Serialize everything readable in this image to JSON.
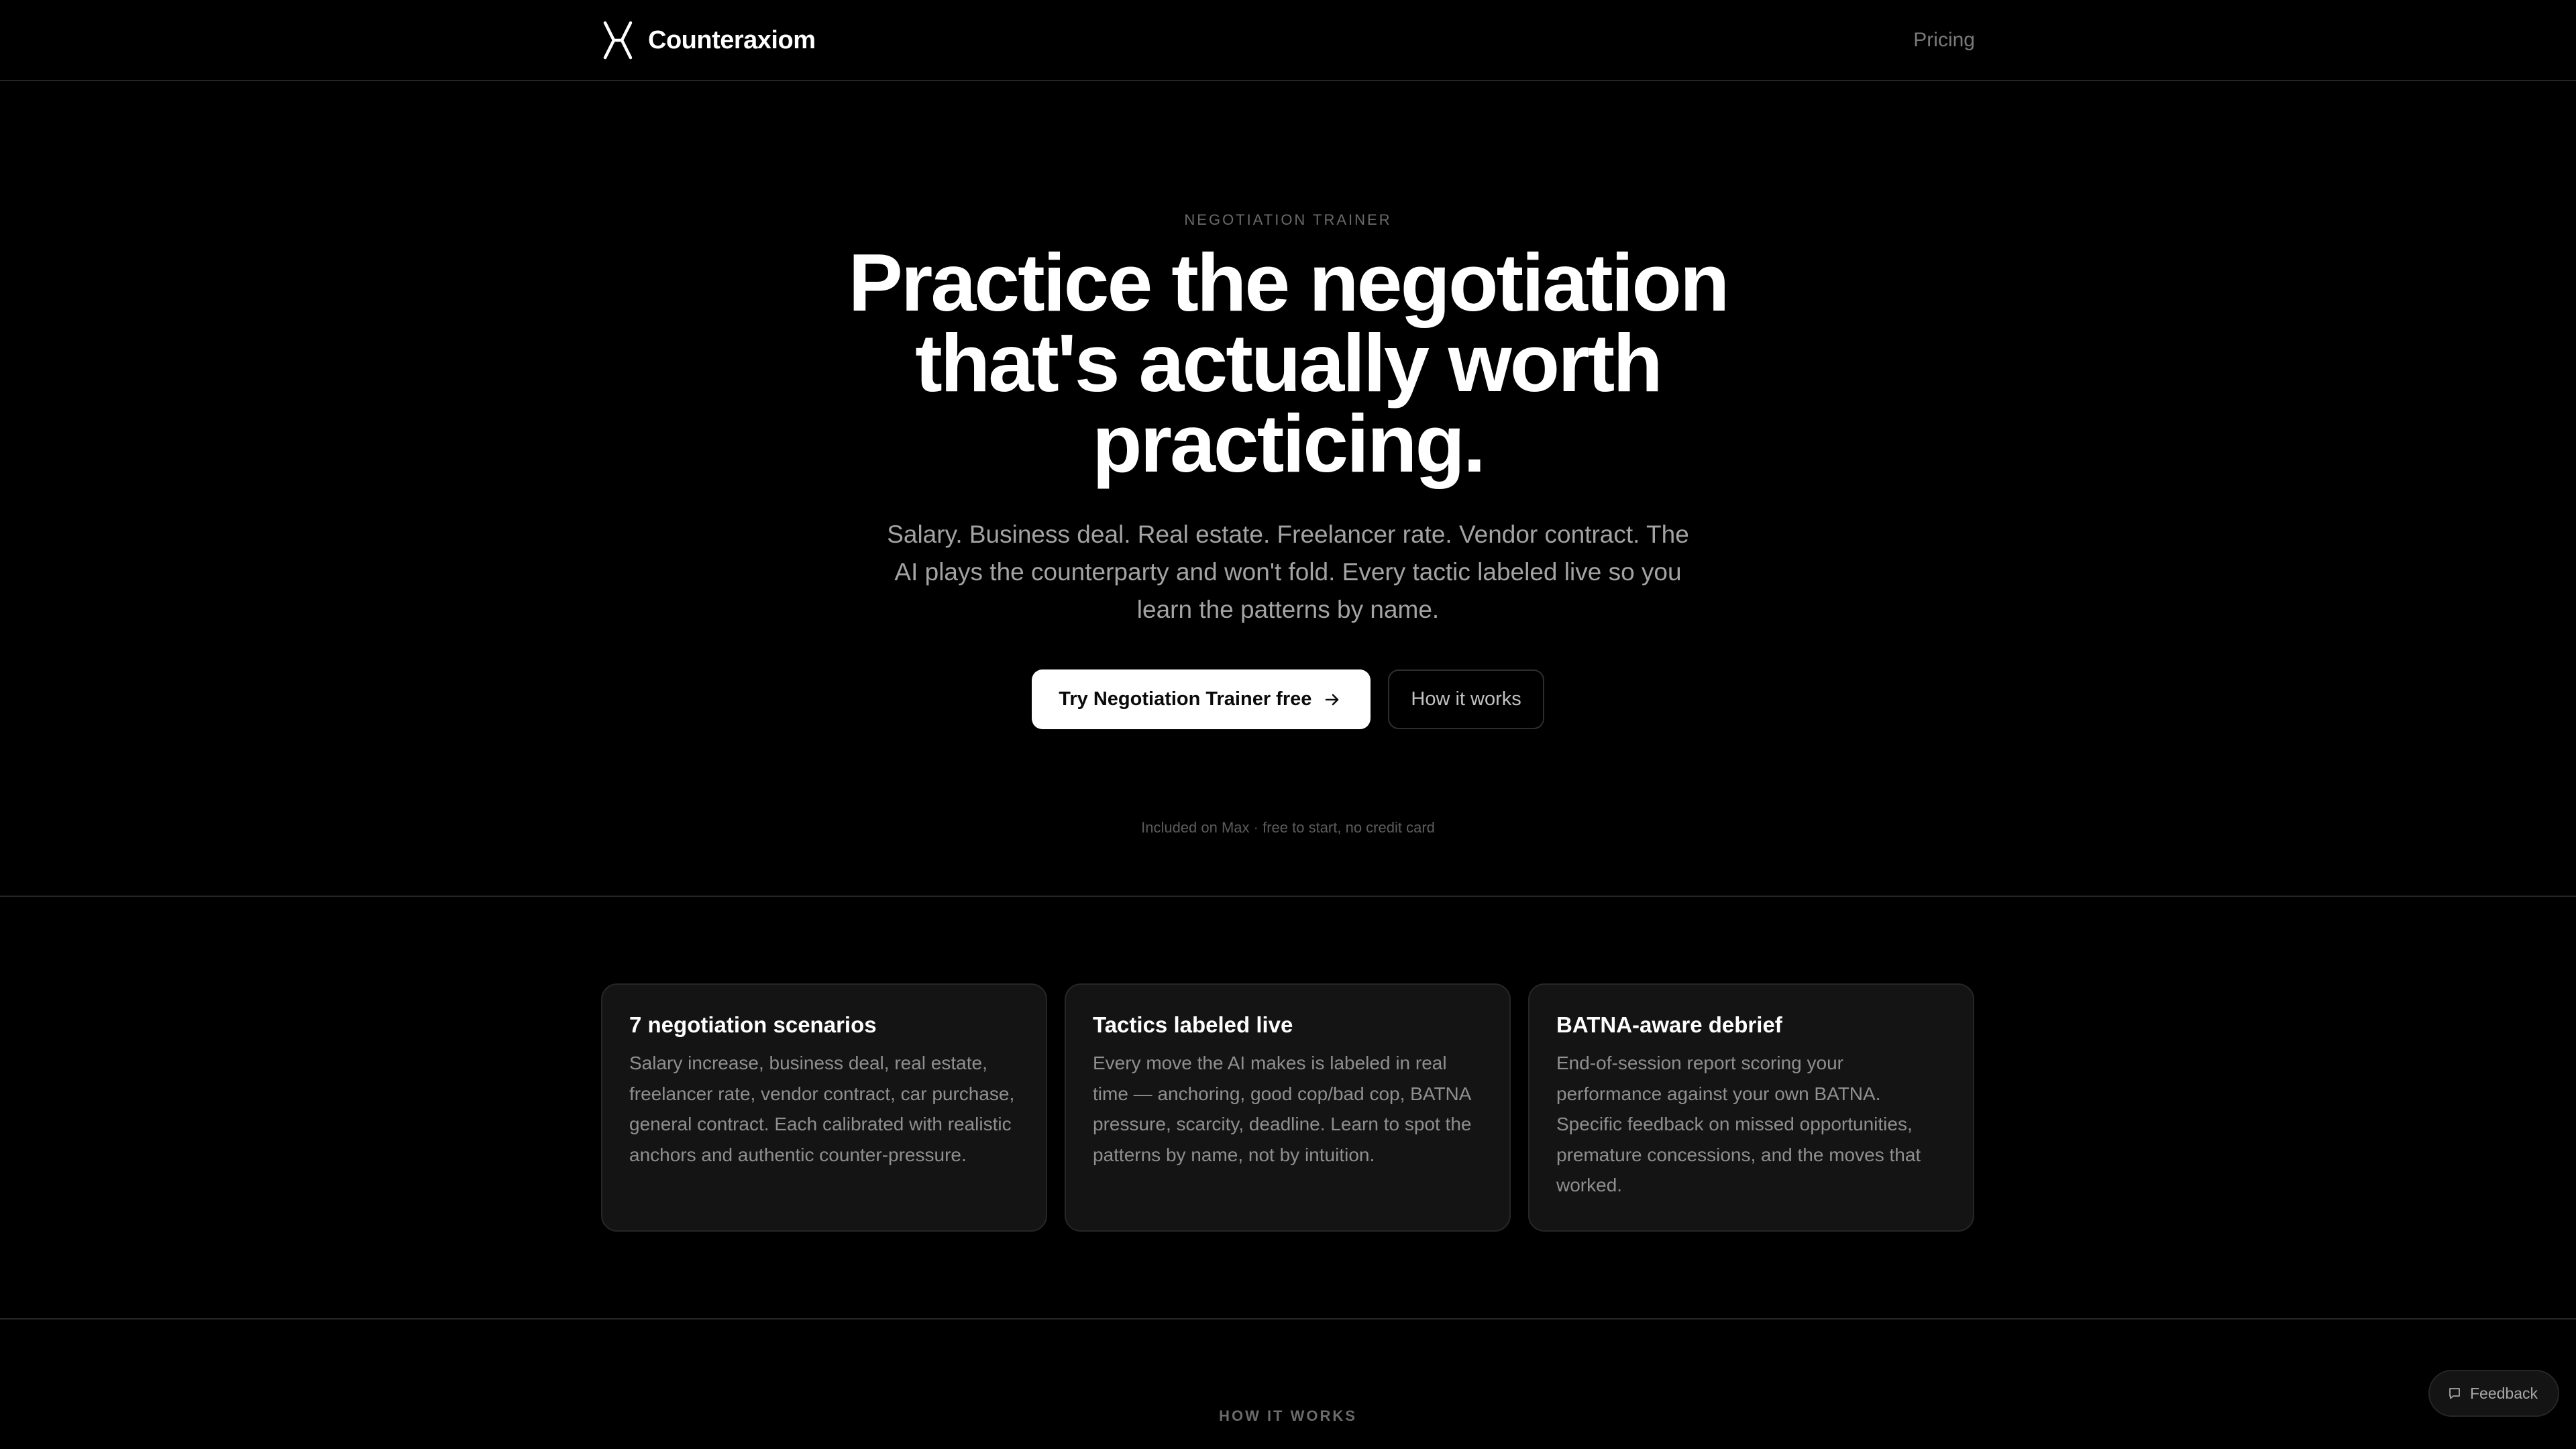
{
  "header": {
    "brand_name": "Counteraxiom",
    "logo_icon": "x-logo-icon",
    "nav_pricing": "Pricing"
  },
  "hero": {
    "eyebrow": "NEGOTIATION TRAINER",
    "headline": "Practice the negotiation that's actually worth practicing.",
    "subhead": "Salary. Business deal. Real estate. Freelancer rate. Vendor contract. The AI plays the counterparty and won't fold. Every tactic labeled live so you learn the patterns by name.",
    "cta_primary": "Try Negotiation Trainer free",
    "cta_primary_icon": "arrow-right-icon",
    "cta_secondary": "How it works",
    "cta_note": "Included on Max · free to start, no credit card"
  },
  "features": [
    {
      "title": "7 negotiation scenarios",
      "body": "Salary increase, business deal, real estate, freelancer rate, vendor contract, car purchase, general contract. Each calibrated with realistic anchors and authentic counter-pressure."
    },
    {
      "title": "Tactics labeled live",
      "body": "Every move the AI makes is labeled in real time — anchoring, good cop/bad cop, BATNA pressure, scarcity, deadline. Learn to spot the patterns by name, not by intuition."
    },
    {
      "title": "BATNA-aware debrief",
      "body": "End-of-session report scoring your performance against your own BATNA. Specific feedback on missed opportunities, premature concessions, and the moves that worked."
    }
  ],
  "how_it_works": {
    "label": "HOW IT WORKS"
  },
  "feedback": {
    "label": "Feedback",
    "icon": "chat-bubble-icon"
  },
  "colors": {
    "background": "#000000",
    "text": "#ffffff",
    "muted_text": "#a3a3a3",
    "card_background": "#141414",
    "border": "#262626",
    "primary_button": "#ffffff"
  }
}
